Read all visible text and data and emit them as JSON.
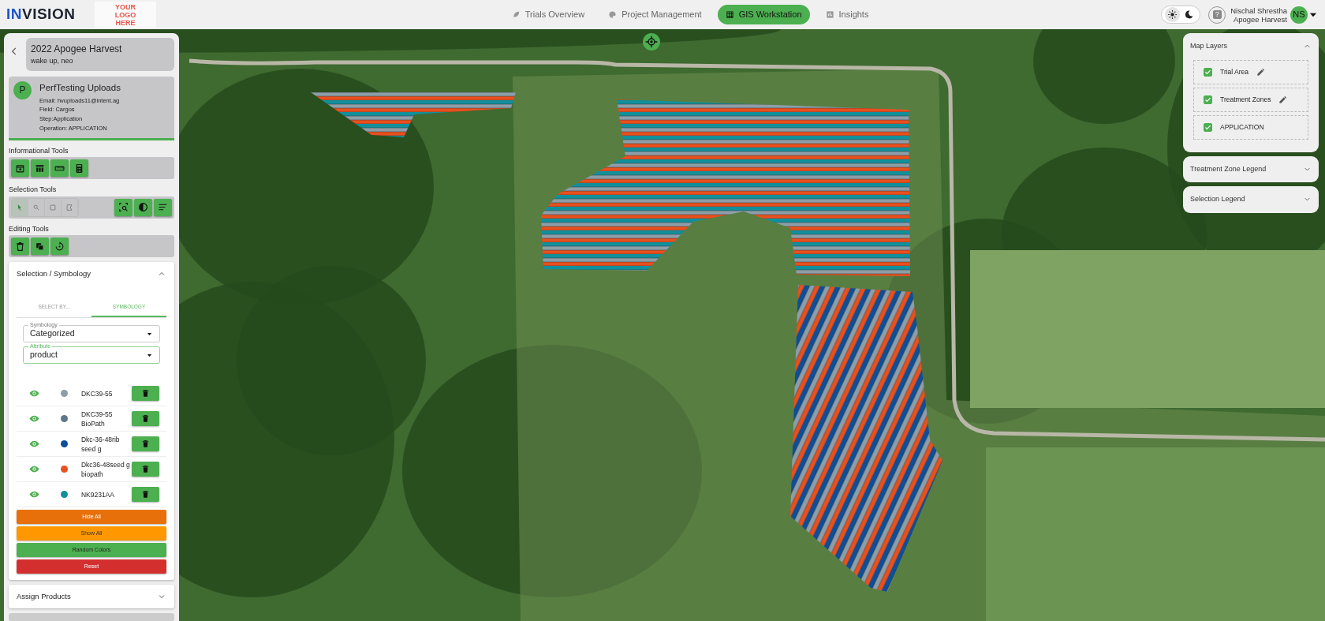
{
  "header": {
    "logo": {
      "accent": "IN",
      "rest": "VISION"
    },
    "logo_placeholder": "YOUR LOGO HERE",
    "nav": [
      {
        "label": "Trials Overview",
        "selected": false
      },
      {
        "label": "Project Management",
        "selected": false
      },
      {
        "label": "GIS Workstation",
        "selected": true
      },
      {
        "label": "Insights",
        "selected": false
      }
    ],
    "theme": [
      {
        "kind": "light",
        "selected": true
      },
      {
        "kind": "dark",
        "selected": false
      }
    ],
    "help": "?",
    "user": {
      "name": "Nischal Shrestha",
      "org": "Apogee Harvest",
      "initials": "NS"
    }
  },
  "sidebar": {
    "project": {
      "title": "2022 Apogee Harvest",
      "subtitle": "wake up, neo"
    },
    "profile": {
      "initial": "P",
      "name": "PerfTesting Uploads",
      "details": [
        "Email: hvuploads11@intent.ag",
        "Field: Cargos",
        "Step:Application",
        "Operation: APPLICATION"
      ]
    },
    "tool_groups": [
      {
        "title": "Informational Tools"
      },
      {
        "title": "Selection Tools",
        "modes": [
          {
            "selected": true
          },
          {
            "selected": false
          },
          {
            "selected": false
          },
          {
            "selected": false
          }
        ]
      },
      {
        "title": "Editing Tools"
      }
    ],
    "symbology_panel": {
      "title": "Selection / Symbology",
      "expanded": true,
      "tabs": [
        {
          "label": "SELECT BY...",
          "selected": false
        },
        {
          "label": "SYMBOLOGY",
          "selected": true
        }
      ],
      "fields": [
        {
          "label": "Symbology",
          "value": "Categorized",
          "focused": false
        },
        {
          "label": "Attribute",
          "value": "product",
          "focused": true
        }
      ],
      "legend": [
        {
          "label": "DKC39-55",
          "color": "#8e9ea8",
          "visible": true
        },
        {
          "label": "DKC39-55 BioPath",
          "color": "#5f7888",
          "visible": true
        },
        {
          "label": "Dkc-36-48rib seed g",
          "color": "#0d4e98",
          "visible": true
        },
        {
          "label": "Dkc36-48seed g biopath",
          "color": "#e8501e",
          "visible": true
        },
        {
          "label": "NK9231AA",
          "color": "#11909c",
          "visible": true
        }
      ],
      "actions": [
        {
          "label": "Hide All",
          "kind": "hide"
        },
        {
          "label": "Show All",
          "kind": "show"
        },
        {
          "label": "Random Colors",
          "kind": "random"
        },
        {
          "label": "Reset",
          "kind": "reset"
        }
      ]
    },
    "assign_panel": {
      "title": "Assign Products",
      "expanded": false
    }
  },
  "map": {
    "layers_panel": {
      "title": "Map Layers",
      "expanded": true,
      "layers": [
        {
          "label": "Trial Area",
          "checked": true,
          "editable": true
        },
        {
          "label": "Treatment Zones",
          "checked": true,
          "editable": true
        },
        {
          "label": "APPLICATION",
          "checked": true,
          "editable": false
        }
      ]
    },
    "legend_panels": [
      {
        "title": "Treatment Zone Legend",
        "expanded": false
      },
      {
        "title": "Selection Legend",
        "expanded": false
      }
    ]
  }
}
